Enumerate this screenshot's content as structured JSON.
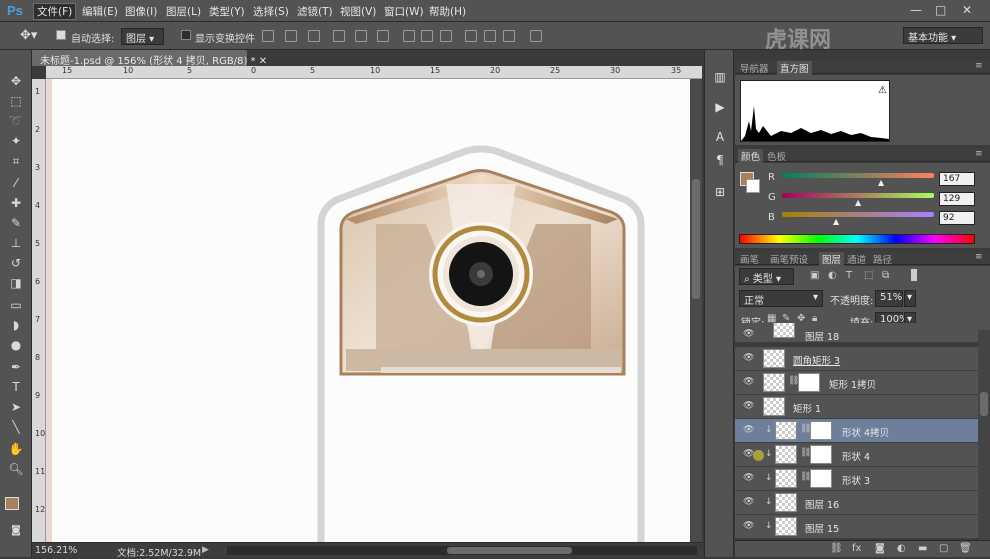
{
  "app": {
    "logo": "Ps",
    "watermark": "虎课网"
  },
  "menu": [
    "文件(F)",
    "编辑(E)",
    "图像(I)",
    "图层(L)",
    "类型(Y)",
    "选择(S)",
    "滤镜(T)",
    "视图(V)",
    "窗口(W)",
    "帮助(H)"
  ],
  "window_controls": [
    "—",
    "□",
    "✕"
  ],
  "options": {
    "auto_select_label": "自动选择:",
    "auto_select_value": "图层",
    "show_transform_label": "显示变换控件",
    "workspace": "基本功能"
  },
  "document": {
    "tab_title": "未标题-1.psd @ 156% (形状 4 拷贝, RGB/8) *",
    "ruler_top": [
      "15",
      "10",
      "5",
      "0",
      "5",
      "10",
      "15",
      "20",
      "25",
      "30",
      "35"
    ],
    "ruler_left": [
      "1",
      "2",
      "3",
      "4",
      "5",
      "6",
      "7",
      "8",
      "9",
      "10",
      "11",
      "12"
    ]
  },
  "status": {
    "zoom": "156.21%",
    "doc": "文档:2.52M/32.9M"
  },
  "navigator": {
    "tabs": [
      "导航器",
      "直方图"
    ]
  },
  "color_panel": {
    "tabs": [
      "颜色",
      "色板"
    ],
    "swatch": "#a7815c",
    "r_label": "R",
    "r": "167",
    "g_label": "G",
    "g": "129",
    "b_label": "B",
    "b": "92"
  },
  "layers_panel": {
    "tabs": [
      "画笔",
      "画笔预设",
      "图层",
      "通道",
      "路径"
    ],
    "filter_kind": "类型",
    "blend_mode": "正常",
    "opacity_label": "不透明度:",
    "opacity": "51%",
    "lock_label": "锁定:",
    "fill_label": "填充:",
    "fill": "100%",
    "layers": [
      {
        "name": "图层 18",
        "kind": "pixel",
        "clip": false,
        "mask": false,
        "selected": false
      },
      {
        "name": "圆角矩形 3",
        "kind": "shape",
        "clip": false,
        "mask": false,
        "selected": false
      },
      {
        "name": "矩形 1拷贝",
        "kind": "shape",
        "clip": false,
        "mask": true,
        "selected": false
      },
      {
        "name": "矩形 1",
        "kind": "shape",
        "clip": false,
        "mask": false,
        "selected": false
      },
      {
        "name": "形状 4拷贝",
        "kind": "shape",
        "clip": true,
        "mask": true,
        "selected": true
      },
      {
        "name": "形状 4",
        "kind": "shape",
        "clip": true,
        "mask": true,
        "selected": false
      },
      {
        "name": "形状 3",
        "kind": "shape",
        "clip": true,
        "mask": true,
        "selected": false
      },
      {
        "name": "图层 16",
        "kind": "pixel",
        "clip": true,
        "mask": false,
        "selected": false
      },
      {
        "name": "图层 15",
        "kind": "pixel",
        "clip": true,
        "mask": false,
        "selected": false
      }
    ]
  }
}
